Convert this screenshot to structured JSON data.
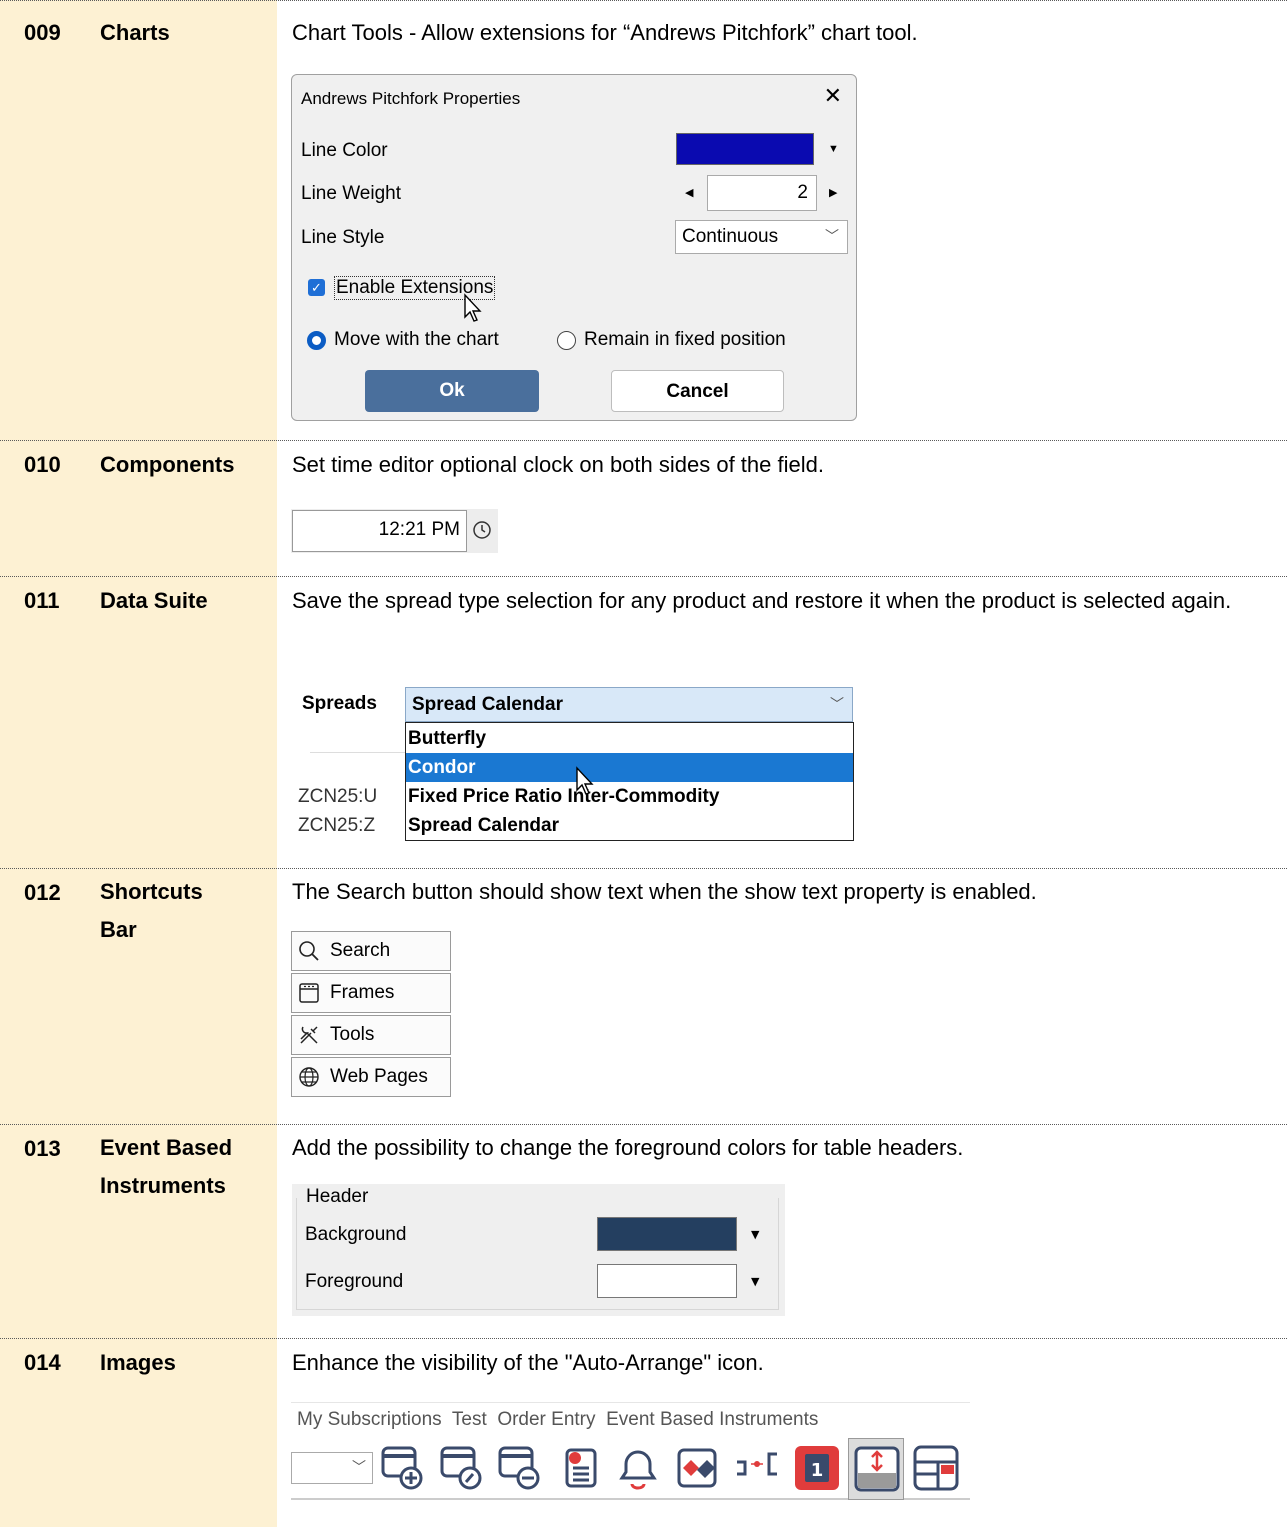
{
  "rows": [
    {
      "num": "009",
      "category": "Charts",
      "description": "Chart Tools - Allow extensions for “Andrews Pitchfork” chart tool."
    },
    {
      "num": "010",
      "category": "Components",
      "description": "Set time editor optional clock on both sides of the field."
    },
    {
      "num": "011",
      "category": "Data Suite",
      "description": "Save the spread type selection for any product and restore it when the product is selected again."
    },
    {
      "num": "012",
      "category": "Shortcuts Bar",
      "category_line1": "Shortcuts",
      "category_line2": "Bar",
      "description": "The Search button should show text when the show text property is enabled."
    },
    {
      "num": "013",
      "category": "Event Based Instruments",
      "category_line1": "Event Based",
      "category_line2": "Instruments",
      "description": "Add the possibility to change the foreground colors for table headers."
    },
    {
      "num": "014",
      "category": "Images",
      "description": "Enhance the visibility of the \"Auto-Arrange\" icon."
    }
  ],
  "pitchfork_dialog": {
    "title": "Andrews Pitchfork Properties",
    "close_glyph": "✕",
    "line_color_label": "Line Color",
    "line_color": "#0a0ab0",
    "line_weight_label": "Line Weight",
    "line_weight_value": "2",
    "line_style_label": "Line Style",
    "line_style_value": "Continuous",
    "enable_extensions_label": "Enable Extensions",
    "enable_extensions_checked": true,
    "radio_move_label": "Move with the chart",
    "radio_fixed_label": "Remain in fixed position",
    "radio_selected": "move",
    "ok_label": "Ok",
    "cancel_label": "Cancel"
  },
  "time_editor": {
    "value": "12:21 PM",
    "icon": "clock-icon"
  },
  "spreads": {
    "label": "Spreads",
    "selected": "Spread Calendar",
    "options": [
      "Butterfly",
      "Condor",
      "Fixed Price Ratio Inter-Commodity",
      "Spread Calendar"
    ],
    "highlighted": "Condor",
    "background_rows": [
      "ZCN25:U",
      "ZCN25:Z"
    ]
  },
  "shortcuts": [
    {
      "label": "Search",
      "icon": "search-icon"
    },
    {
      "label": "Frames",
      "icon": "frames-icon"
    },
    {
      "label": "Tools",
      "icon": "tools-icon"
    },
    {
      "label": "Web Pages",
      "icon": "globe-icon"
    }
  ],
  "header_colors": {
    "group_label": "Header",
    "background_label": "Background",
    "background_color": "#243f60",
    "foreground_label": "Foreground",
    "foreground_color": "#ffffff"
  },
  "toolbar": {
    "tabs": [
      "My Subscriptions",
      "Test",
      "Order Entry",
      "Event Based Instruments"
    ],
    "icons": [
      "add-window-icon",
      "edit-window-icon",
      "remove-window-icon",
      "report-icon",
      "alert-bell-icon",
      "instrument-icon",
      "link-icon",
      "one-instance-icon",
      "auto-arrange-icon",
      "layout-icon"
    ],
    "one_badge": "1"
  }
}
